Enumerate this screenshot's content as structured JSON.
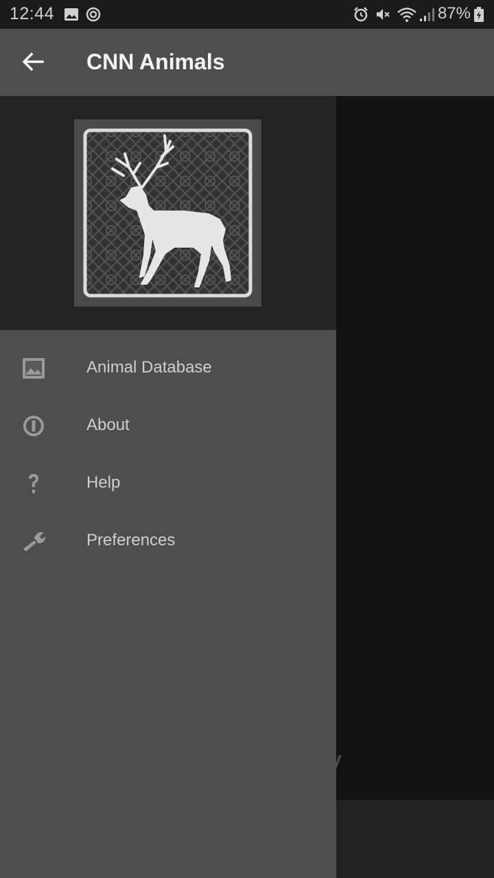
{
  "status_bar": {
    "time": "12:44",
    "battery": "87%",
    "icons": [
      "image-icon",
      "sync-icon",
      "alarm-icon",
      "mute-icon",
      "wifi-icon",
      "signal-icon",
      "battery-icon"
    ]
  },
  "app_bar": {
    "title": "CNN Animals",
    "back_icon": "arrow-back-icon"
  },
  "drawer": {
    "header_logo": "deer-logo",
    "items": [
      {
        "label": "Animal Database",
        "icon": "image-icon"
      },
      {
        "label": "About",
        "icon": "info-icon"
      },
      {
        "label": "Help",
        "icon": "help-icon"
      },
      {
        "label": "Preferences",
        "icon": "wrench-icon"
      }
    ]
  },
  "main": {
    "partial_text": "ssify"
  },
  "colors": {
    "status_bar": "#1b1b1b",
    "app_bar": "#4e4e4e",
    "drawer_bg": "#4e4e4e",
    "drawer_header": "#232323",
    "scrim": "#121212",
    "menu_text": "#cfcfcf"
  }
}
